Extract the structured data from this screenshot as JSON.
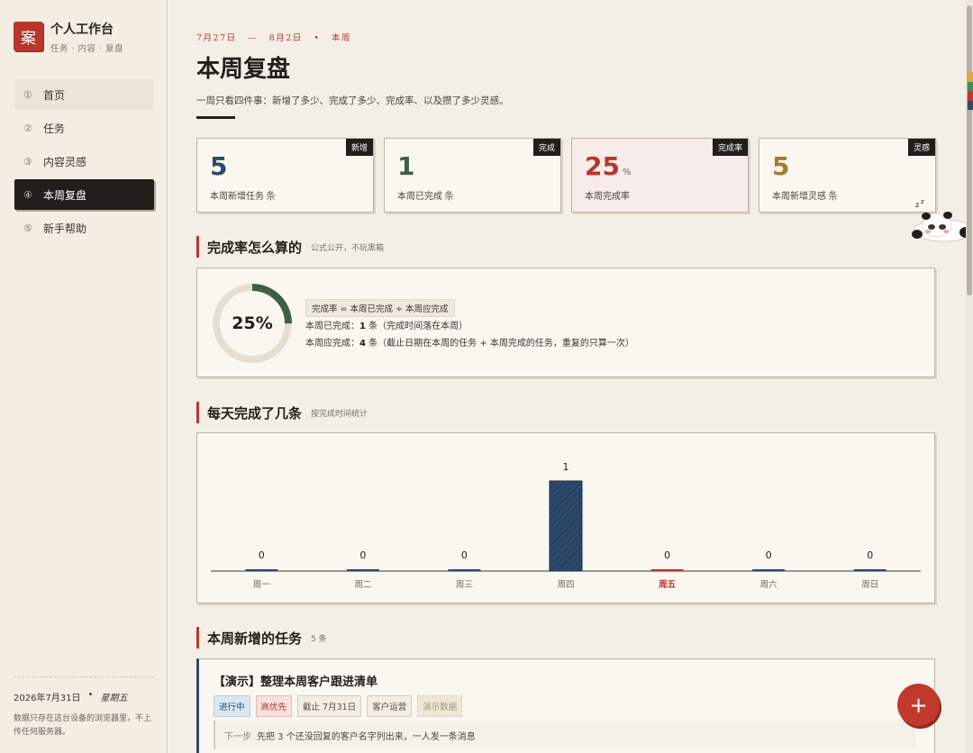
{
  "sidebar": {
    "brand_seal": "案",
    "brand_title": "个人工作台",
    "brand_subtitle": "任务 · 内容 · 复盘",
    "items": [
      {
        "num": "①",
        "label": "首页"
      },
      {
        "num": "②",
        "label": "任务"
      },
      {
        "num": "③",
        "label": "内容灵感"
      },
      {
        "num": "④",
        "label": "本周复盘"
      },
      {
        "num": "⑤",
        "label": "新手帮助"
      }
    ],
    "active_index": 3,
    "footer_date": "2026年7月31日",
    "footer_sep": "•",
    "footer_weekday": "星期五",
    "footer_note": "数据只存在这台设备的浏览器里，不上传任何服务器。"
  },
  "header": {
    "range_start": "7月27日",
    "range_dash": "—",
    "range_end": "8月2日",
    "range_dot": "•",
    "range_label": "本周",
    "title": "本周复盘",
    "description": "一周只看四件事：新增了多少、完成了多少、完成率、以及攒了多少灵感。"
  },
  "stats": [
    {
      "tag": "新增",
      "value": "5",
      "unit_top": "",
      "label": "本周新增任务",
      "unit": "条",
      "color": "#2c4a6b"
    },
    {
      "tag": "完成",
      "value": "1",
      "unit_top": "",
      "label": "本周已完成",
      "unit": "条",
      "color": "#3f5e46"
    },
    {
      "tag": "完成率",
      "value": "25",
      "unit_top": "%",
      "label": "本周完成率",
      "unit": "",
      "color": "#b8362c"
    },
    {
      "tag": "灵感",
      "value": "5",
      "unit_top": "",
      "label": "本周新增灵感",
      "unit": "条",
      "color": "#a97a2c"
    }
  ],
  "rate_section": {
    "heading": "完成率怎么算的",
    "subheading": "公式公开，不玩黑箱",
    "ring_text": "25%",
    "ring_fraction": 0.25,
    "formula": "完成率 = 本周已完成 ÷ 本周应完成",
    "done_label": "本周已完成：",
    "done_value": "1",
    "done_rest": " 条（完成时间落在本周）",
    "due_label": "本周应完成：",
    "due_value": "4",
    "due_rest": " 条（截止日期在本周的任务 + 本周完成的任务，重复的只算一次）"
  },
  "daily_section": {
    "heading": "每天完成了几条",
    "subheading": "按完成时间统计"
  },
  "chart_data": {
    "type": "bar",
    "categories": [
      "周一",
      "周二",
      "周三",
      "周四",
      "周五",
      "周六",
      "周日"
    ],
    "values": [
      0,
      0,
      0,
      1,
      0,
      0,
      0
    ],
    "highlight_category": "周五",
    "ylim": [
      0,
      1
    ],
    "colors": {
      "bar": "#2c4a6b",
      "today": "#b8362c"
    }
  },
  "new_tasks_section": {
    "heading": "本周新增的任务",
    "count": "5 条"
  },
  "task": {
    "title": "【演示】整理本周客户跟进清单",
    "chips": [
      {
        "text": "进行中",
        "style": "blue"
      },
      {
        "text": "高优先",
        "style": "red"
      },
      {
        "text": "截止 7月31日",
        "style": ""
      },
      {
        "text": "客户运营",
        "style": ""
      },
      {
        "text": "演示数据",
        "style": "demo"
      }
    ],
    "next_label": "下一步",
    "next_text": "先把 3 个还没回复的客户名字列出来，一人发一条消息"
  },
  "fab_label": "+"
}
